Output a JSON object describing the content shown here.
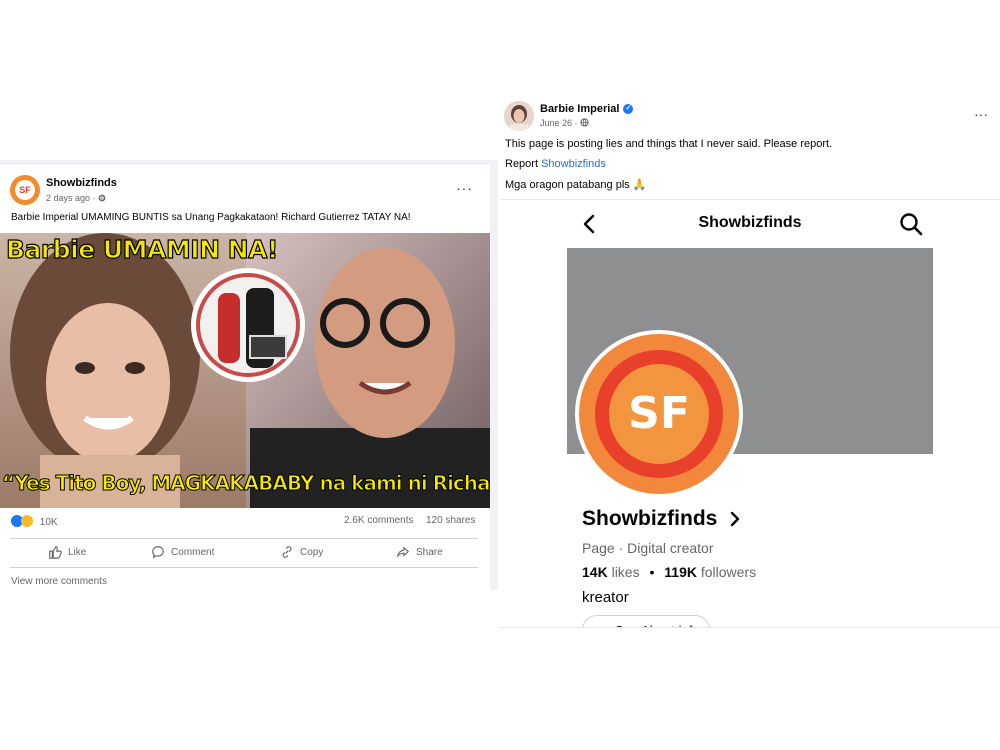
{
  "left_post": {
    "page_name": "Showbizfinds",
    "time": "2 days ago ·",
    "caption": "Barbie Imperial UMAMING BUNTIS sa Unang Pagkakataon! Richard Gutierrez TATAY NA!",
    "image": {
      "headline": "Barbie UMAMIN NA!",
      "quote": "“Yes Tito Boy, MAGKAKABABY na kami ni Richard”"
    },
    "reactions_count": "10K",
    "comments": "2.6K comments",
    "shares": "120 shares",
    "actions": [
      "Like",
      "Comment",
      "Copy",
      "Share"
    ],
    "view_more": "View more comments",
    "avatar_text": "SF",
    "menu": "···"
  },
  "right_post": {
    "author": "Barbie Imperial",
    "time": "June 26 ·",
    "text_line1": "This page is posting lies and things that I never said. Please report.",
    "report_prefix": "Report ",
    "report_link": "Showbizfinds",
    "text_line3": "Mga oragon patabang pls",
    "emoji": "🙏",
    "menu": "···"
  },
  "phone": {
    "title": "Showbizfinds",
    "logo_text": "SF",
    "page_name": "Showbizfinds",
    "page_type": "Page · Digital creator",
    "likes_value": "14K",
    "likes_label": "likes",
    "bullet": "•",
    "followers_value": "119K",
    "followers_label": "followers",
    "category": "kreator",
    "button_label": "See About info"
  },
  "colors": {
    "link_blue": "#216fdb",
    "verified_blue": "#1877f2",
    "sf_orange": "#f2883c",
    "sf_red": "#e8402b",
    "meme_yellow": "#f5e900"
  },
  "icons": [
    "settings-icon",
    "globe-icon",
    "verified-icon",
    "like-icon",
    "comment-icon",
    "copy-icon",
    "share-icon",
    "back-chevron-icon",
    "search-icon",
    "chevron-right-icon"
  ]
}
